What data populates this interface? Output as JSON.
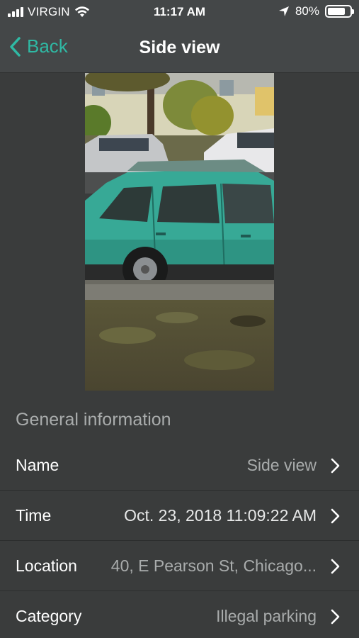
{
  "status_bar": {
    "carrier": "VIRGIN",
    "time": "11:17 AM",
    "battery": "80%",
    "battery_level": 0.8
  },
  "nav": {
    "back_label": "Back",
    "title": "Side view"
  },
  "icons": {
    "back": "chevron-left-icon",
    "row": "chevron-right-icon",
    "wifi": "wifi-icon",
    "location": "location-arrow-icon",
    "signal": "signal-bars-icon",
    "battery": "battery-icon"
  },
  "colors": {
    "accent": "#2fb9a4",
    "background": "#3a3c3c",
    "secondary_text": "#a9acac"
  },
  "photo": {
    "description_icon": "car-photo"
  },
  "section": {
    "title": "General information"
  },
  "fields": [
    {
      "label": "Name",
      "value": "Side view"
    },
    {
      "label": "Time",
      "value": "Oct. 23, 2018 11:09:22 AM"
    },
    {
      "label": "Location",
      "value": "40, E Pearson St, Chicago..."
    },
    {
      "label": "Category",
      "value": "Illegal parking"
    }
  ]
}
